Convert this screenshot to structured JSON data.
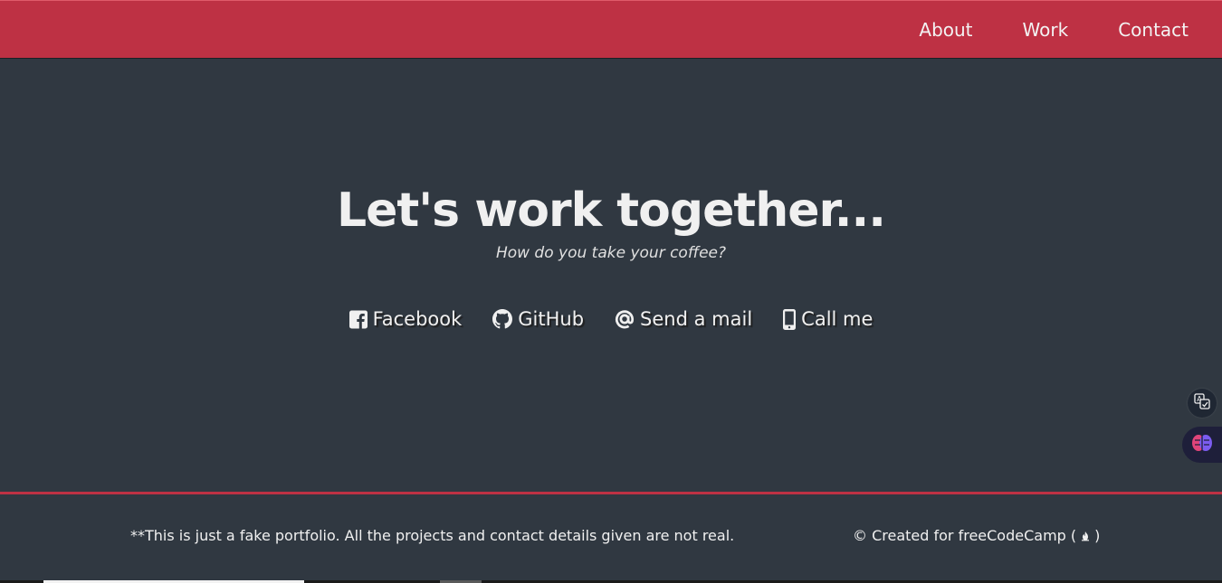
{
  "nav": {
    "items": [
      {
        "label": "About"
      },
      {
        "label": "Work"
      },
      {
        "label": "Contact"
      }
    ]
  },
  "contact": {
    "title": "Let's work together...",
    "subtitle": "How do you take your coffee?",
    "links": [
      {
        "label": "Facebook",
        "icon": "facebook-square-icon"
      },
      {
        "label": "GitHub",
        "icon": "github-icon"
      },
      {
        "label": "Send a mail",
        "icon": "at-icon"
      },
      {
        "label": "Call me",
        "icon": "mobile-phone-icon"
      }
    ]
  },
  "footer": {
    "note": "**This is just a fake portfolio. All the projects and contact details given are not real.",
    "credit_prefix": "© Created for freeCodeCamp (",
    "credit_suffix": ")",
    "credit_icon": "freecodecamp-fire-icon"
  },
  "widgets": {
    "translate_icon": "translate-icon",
    "brain_icon": "brain-icon"
  },
  "colors": {
    "nav_background": "#be3144",
    "page_background": "#303841",
    "text": "#f0f0f0",
    "footer_border": "#be3144"
  }
}
